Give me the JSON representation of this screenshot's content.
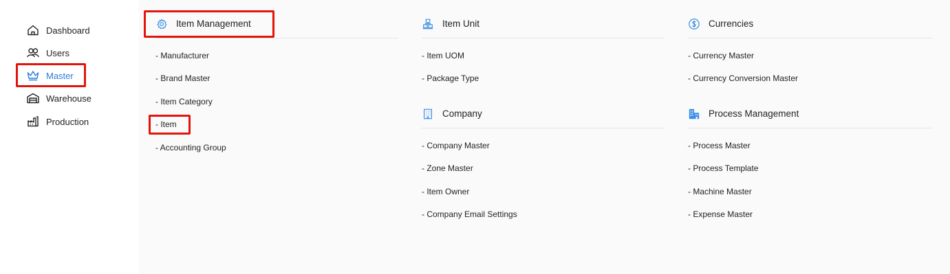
{
  "sidebar": {
    "items": [
      {
        "label": "Dashboard",
        "icon": "home-icon"
      },
      {
        "label": "Users",
        "icon": "users-icon"
      },
      {
        "label": "Master",
        "icon": "crown-icon",
        "active": true
      },
      {
        "label": "Warehouse",
        "icon": "warehouse-icon"
      },
      {
        "label": "Production",
        "icon": "factory-icon"
      }
    ]
  },
  "sections": {
    "item_management": {
      "title": "Item Management",
      "icon": "gear-icon",
      "links": [
        "- Manufacturer",
        "- Brand Master",
        "- Item Category",
        "- Item",
        "- Accounting Group"
      ]
    },
    "item_unit": {
      "title": "Item Unit",
      "icon": "boxes-icon",
      "links": [
        "- Item UOM",
        "- Package Type"
      ]
    },
    "company": {
      "title": "Company",
      "icon": "building-icon",
      "links": [
        "- Company Master",
        "- Zone Master",
        "- Item Owner",
        "- Company Email Settings"
      ]
    },
    "currencies": {
      "title": "Currencies",
      "icon": "dollar-circle-icon",
      "links": [
        "- Currency Master",
        "- Currency Conversion Master"
      ]
    },
    "process_management": {
      "title": "Process Management",
      "icon": "city-buildings-icon",
      "links": [
        "- Process Master",
        "- Process Template",
        "- Machine Master",
        "- Expense Master"
      ]
    }
  },
  "colors": {
    "accent": "#2b7bd9",
    "highlight": "#e3120b",
    "icon_blue": "#3a8ee6"
  }
}
